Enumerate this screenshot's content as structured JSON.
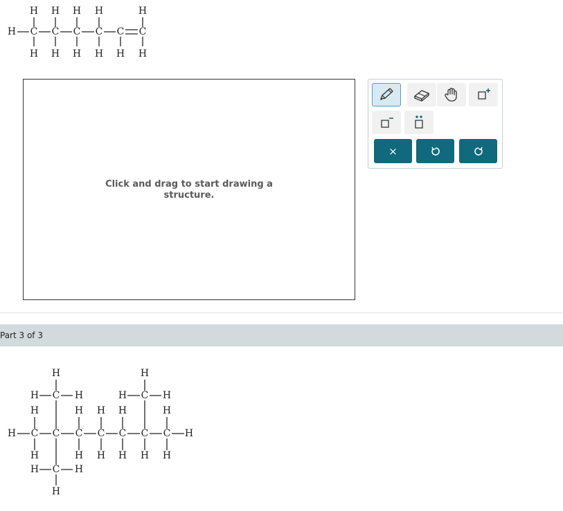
{
  "top_structure": {
    "atom_h": "H",
    "atom_c": "C"
  },
  "canvas": {
    "hint_line1": "Click and drag to start drawing a",
    "hint_line2": "structure."
  },
  "toolbar": {
    "tools": [
      "pencil",
      "eraser",
      "hand",
      "add-positive-charge",
      "add-negative-charge",
      "lone-pair"
    ],
    "clear_label": "×",
    "undo_icon": "undo-icon",
    "redo_icon": "redo-icon",
    "accent_color": "#10697c"
  },
  "part": {
    "label": "Part 3 of 3"
  }
}
